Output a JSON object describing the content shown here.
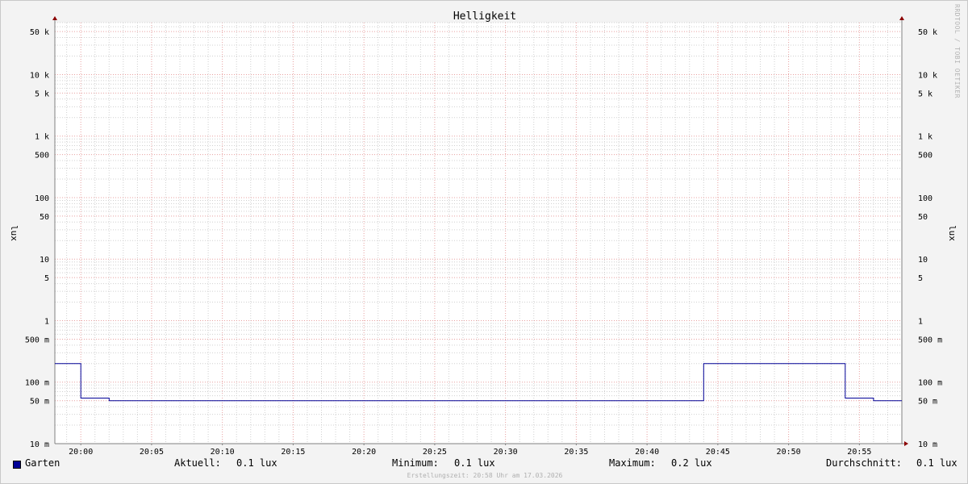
{
  "chart_data": {
    "type": "line",
    "title": "Helligkeit",
    "ylabel": "lux",
    "ylabel_right": "lux",
    "yscale": "log",
    "ylim": [
      0.01,
      70000
    ],
    "xlim": [
      "19:58:10",
      "20:58:00"
    ],
    "x_ticks": [
      "20:00",
      "20:05",
      "20:10",
      "20:15",
      "20:20",
      "20:25",
      "20:30",
      "20:35",
      "20:40",
      "20:45",
      "20:50",
      "20:55"
    ],
    "y_ticks": [
      {
        "value": 50000,
        "label": "50 k"
      },
      {
        "value": 10000,
        "label": "10 k"
      },
      {
        "value": 5000,
        "label": "5 k"
      },
      {
        "value": 1000,
        "label": "1 k"
      },
      {
        "value": 500,
        "label": "500"
      },
      {
        "value": 100,
        "label": "100"
      },
      {
        "value": 50,
        "label": "50"
      },
      {
        "value": 10,
        "label": "10"
      },
      {
        "value": 5,
        "label": "5"
      },
      {
        "value": 1,
        "label": "1"
      },
      {
        "value": 0.5,
        "label": "500 m"
      },
      {
        "value": 0.1,
        "label": "100 m"
      },
      {
        "value": 0.05,
        "label": "50 m"
      },
      {
        "value": 0.01,
        "label": "10 m"
      }
    ],
    "grid": true,
    "series": [
      {
        "name": "Garten",
        "color": "#000096",
        "points": [
          {
            "x": "19:58:10",
            "y": 0.2
          },
          {
            "x": "20:00:00",
            "y": 0.2
          },
          {
            "x": "20:00:00",
            "y": 0.055
          },
          {
            "x": "20:02:00",
            "y": 0.055
          },
          {
            "x": "20:02:00",
            "y": 0.05
          },
          {
            "x": "20:44:00",
            "y": 0.05
          },
          {
            "x": "20:44:00",
            "y": 0.2
          },
          {
            "x": "20:54:00",
            "y": 0.2
          },
          {
            "x": "20:54:00",
            "y": 0.055
          },
          {
            "x": "20:56:00",
            "y": 0.055
          },
          {
            "x": "20:56:00",
            "y": 0.05
          },
          {
            "x": "20:58:00",
            "y": 0.05
          }
        ]
      }
    ]
  },
  "legend": {
    "series_name": "Garten",
    "aktuell_label": "Aktuell:",
    "aktuell_value": "0.1 lux",
    "minimum_label": "Minimum:",
    "minimum_value": "0.1 lux",
    "maximum_label": "Maximum:",
    "maximum_value": "0.2 lux",
    "avg_label": "Durchschnitt:",
    "avg_value": "0.1 lux"
  },
  "footer": "Erstellungszeit: 20:58 Uhr am 17.03.2026",
  "credit": "RRDTOOL / TOBI OETIKER",
  "colors": {
    "line": "#000096",
    "major_grid": "#e8a0a0",
    "minor_grid": "#d0d0d0",
    "arrow": "#8b0000",
    "background": "#f3f3f3",
    "plot_background": "#ffffff"
  }
}
